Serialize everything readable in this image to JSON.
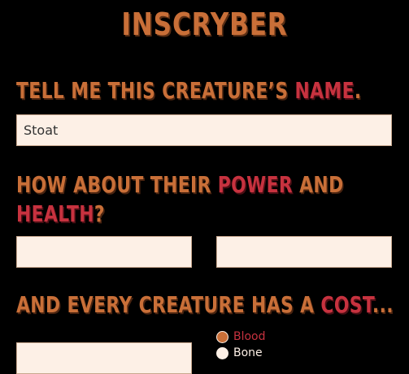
{
  "app": {
    "title": "INSCRYBER"
  },
  "sections": {
    "name": {
      "heading_before": "TELL ME THIS CREATURE’S ",
      "heading_accent": "NAME",
      "heading_after": ".",
      "value": "Stoat"
    },
    "stats": {
      "heading_before": "HOW ABOUT THEIR ",
      "heading_accent1": "POWER",
      "heading_middle": " AND",
      "heading_accent2": "HEALTH",
      "heading_after": "?",
      "power_value": "",
      "health_value": ""
    },
    "cost": {
      "heading_before": "AND EVERY CREATURE HAS A ",
      "heading_accent": "COST",
      "heading_after": "...",
      "value": "",
      "options": [
        {
          "label": "Blood",
          "selected": true
        },
        {
          "label": "Bone",
          "selected": false
        }
      ]
    }
  },
  "colors": {
    "heading": "#c96f38",
    "accent": "#c7323f",
    "field_bg": "#fdf0e6",
    "background": "#000000"
  }
}
